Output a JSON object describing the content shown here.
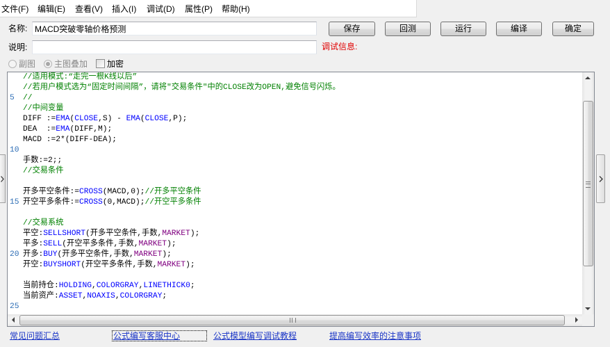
{
  "menu": {
    "items": [
      "文件(F)",
      "编辑(E)",
      "查看(V)",
      "插入(I)",
      "调试(D)",
      "属性(P)",
      "帮助(H)"
    ]
  },
  "form": {
    "name_label": "名称:",
    "name_value": "MACD突破零轴价格预测",
    "desc_label": "说明:",
    "desc_value": "",
    "debug_info_label": "调试信息:",
    "debug_info_color": "#e00000"
  },
  "toolbar": {
    "save": "保存",
    "backtest": "回测",
    "run": "运行",
    "compile": "编译",
    "ok": "确定"
  },
  "options": {
    "subchart": {
      "label": "副图",
      "checked": false,
      "disabled": true
    },
    "main_overlay": {
      "label": "主图叠加",
      "checked": true,
      "disabled": true
    },
    "encrypt": {
      "label": "加密",
      "checked": false,
      "disabled": false
    }
  },
  "editor": {
    "line_number_color": "#2c6db5",
    "lines": [
      {
        "no": "",
        "tokens": [
          {
            "text": "//适用模式:“走完一根K线以后”",
            "color": "#008000"
          }
        ]
      },
      {
        "no": "",
        "tokens": [
          {
            "text": "//若用户模式选为“固定时间间隔”，请将\"交易条件\"中的CLOSE改为OPEN,避免信号闪烁。",
            "color": "#008000"
          }
        ]
      },
      {
        "no": "5",
        "tokens": [
          {
            "text": "//",
            "color": "#008000"
          }
        ]
      },
      {
        "no": "",
        "tokens": [
          {
            "text": "//中间变量",
            "color": "#008000"
          }
        ]
      },
      {
        "no": "",
        "tokens": [
          {
            "text": "DIFF :=",
            "color": "#000000"
          },
          {
            "text": "EMA",
            "color": "#0000ff"
          },
          {
            "text": "(",
            "color": "#000000"
          },
          {
            "text": "CLOSE",
            "color": "#0000ff"
          },
          {
            "text": ",S) - ",
            "color": "#000000"
          },
          {
            "text": "EMA",
            "color": "#0000ff"
          },
          {
            "text": "(",
            "color": "#000000"
          },
          {
            "text": "CLOSE",
            "color": "#0000ff"
          },
          {
            "text": ",P);",
            "color": "#000000"
          }
        ]
      },
      {
        "no": "",
        "tokens": [
          {
            "text": "DEA  :=",
            "color": "#000000"
          },
          {
            "text": "EMA",
            "color": "#0000ff"
          },
          {
            "text": "(DIFF,M);",
            "color": "#000000"
          }
        ]
      },
      {
        "no": "",
        "tokens": [
          {
            "text": "MACD :=2*(DIFF-DEA);",
            "color": "#000000"
          }
        ]
      },
      {
        "no": "10",
        "tokens": []
      },
      {
        "no": "",
        "tokens": [
          {
            "text": "手数:=2;;",
            "color": "#000000"
          }
        ]
      },
      {
        "no": "",
        "tokens": [
          {
            "text": "//交易条件",
            "color": "#008000"
          }
        ]
      },
      {
        "no": "",
        "tokens": []
      },
      {
        "no": "",
        "tokens": [
          {
            "text": "开多平空条件:=",
            "color": "#000000"
          },
          {
            "text": "CROSS",
            "color": "#0000ff"
          },
          {
            "text": "(MACD,0);",
            "color": "#000000"
          },
          {
            "text": "//开多平空条件",
            "color": "#008000"
          }
        ]
      },
      {
        "no": "15",
        "tokens": [
          {
            "text": "开空平多条件:=",
            "color": "#000000"
          },
          {
            "text": "CROSS",
            "color": "#0000ff"
          },
          {
            "text": "(0,MACD);",
            "color": "#000000"
          },
          {
            "text": "//开空平多条件",
            "color": "#008000"
          }
        ]
      },
      {
        "no": "",
        "tokens": []
      },
      {
        "no": "",
        "tokens": [
          {
            "text": "//交易系统",
            "color": "#008000"
          }
        ]
      },
      {
        "no": "",
        "tokens": [
          {
            "text": "平空:",
            "color": "#000000"
          },
          {
            "text": "SELLSHORT",
            "color": "#0000ff"
          },
          {
            "text": "(开多平空条件,手数,",
            "color": "#000000"
          },
          {
            "text": "MARKET",
            "color": "#800080"
          },
          {
            "text": ");",
            "color": "#000000"
          }
        ]
      },
      {
        "no": "",
        "tokens": [
          {
            "text": "平多:",
            "color": "#000000"
          },
          {
            "text": "SELL",
            "color": "#0000ff"
          },
          {
            "text": "(开空平多条件,手数,",
            "color": "#000000"
          },
          {
            "text": "MARKET",
            "color": "#800080"
          },
          {
            "text": ");",
            "color": "#000000"
          }
        ]
      },
      {
        "no": "20",
        "tokens": [
          {
            "text": "开多:",
            "color": "#000000"
          },
          {
            "text": "BUY",
            "color": "#0000ff"
          },
          {
            "text": "(开多平空条件,手数,",
            "color": "#000000"
          },
          {
            "text": "MARKET",
            "color": "#800080"
          },
          {
            "text": ");",
            "color": "#000000"
          }
        ]
      },
      {
        "no": "",
        "tokens": [
          {
            "text": "开空:",
            "color": "#000000"
          },
          {
            "text": "BUYSHORT",
            "color": "#0000ff"
          },
          {
            "text": "(开空平多条件,手数,",
            "color": "#000000"
          },
          {
            "text": "MARKET",
            "color": "#800080"
          },
          {
            "text": ");",
            "color": "#000000"
          }
        ]
      },
      {
        "no": "",
        "tokens": []
      },
      {
        "no": "",
        "tokens": [
          {
            "text": "当前持仓:",
            "color": "#000000"
          },
          {
            "text": "HOLDING",
            "color": "#0000ff"
          },
          {
            "text": ",",
            "color": "#000000"
          },
          {
            "text": "COLORGRAY",
            "color": "#0000ff"
          },
          {
            "text": ",",
            "color": "#000000"
          },
          {
            "text": "LINETHICK0",
            "color": "#0000ff"
          },
          {
            "text": ";",
            "color": "#000000"
          }
        ]
      },
      {
        "no": "",
        "tokens": [
          {
            "text": "当前资产:",
            "color": "#000000"
          },
          {
            "text": "ASSET",
            "color": "#0000ff"
          },
          {
            "text": ",",
            "color": "#000000"
          },
          {
            "text": "NOAXIS",
            "color": "#0000ff"
          },
          {
            "text": ",",
            "color": "#000000"
          },
          {
            "text": "COLORGRAY",
            "color": "#0000ff"
          },
          {
            "text": ";",
            "color": "#000000"
          }
        ]
      },
      {
        "no": "25",
        "tokens": []
      }
    ]
  },
  "links": {
    "color": "#1a35c6",
    "faq": "常见问题汇总",
    "support": "公式编写客服中心",
    "tutorial": "公式模型编写调试教程",
    "tips": "提高编写效率的注意事项"
  },
  "icons": {
    "left_panel_toggle": "chevron-right-icon",
    "right_panel_toggle": "chevron-right-icon",
    "scroll_up": "triangle-up-icon",
    "scroll_down": "triangle-down-icon",
    "scroll_left": "triangle-left-icon",
    "scroll_right": "triangle-right-icon"
  }
}
